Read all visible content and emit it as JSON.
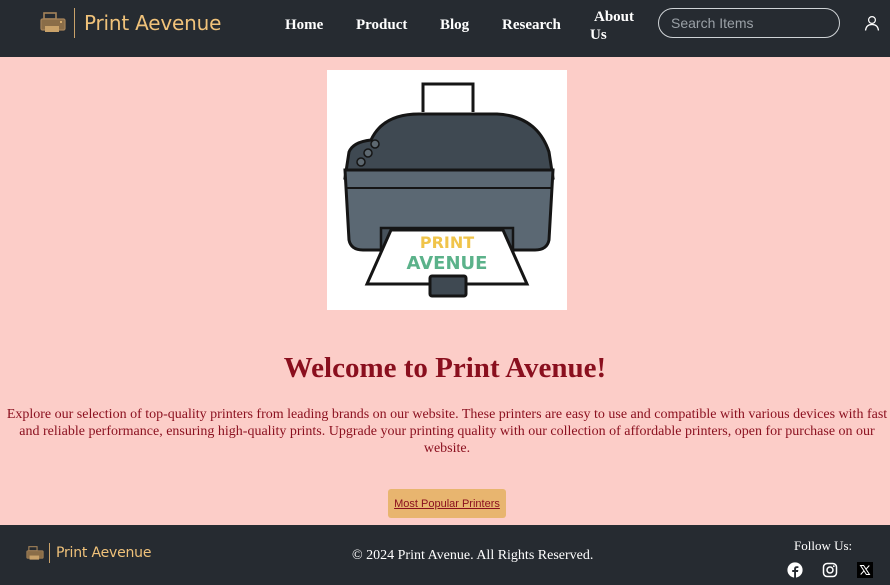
{
  "header": {
    "brand": "Print Aevenue",
    "nav": [
      "Home",
      "Product",
      "Blog",
      "Research"
    ],
    "about_line1": "About",
    "about_line2": "Us",
    "search_placeholder": "Search Items"
  },
  "hero": {
    "image_text_1": "PRINT",
    "image_text_2": "AVENUE",
    "title": "Welcome to Print Avenue!",
    "description": "Explore our selection of top-quality printers from leading brands on our website. These printers are easy to use and compatible with various devices with fast and reliable performance, ensuring high-quality prints. Upgrade your printing quality with our collection of affordable printers, open for purchase on our website.",
    "cta_label": "Most Popular Printers"
  },
  "footer": {
    "brand": "Print Aevenue",
    "copyright": "© 2024 Print Avenue. All Rights Reserved.",
    "follow_label": "Follow Us:",
    "social_icons": [
      "facebook-icon",
      "instagram-icon",
      "x-icon"
    ]
  },
  "colors": {
    "header_bg": "#262b31",
    "page_bg": "#fccdc8",
    "accent": "#8a0f1e",
    "brand_gold": "#f0c27a",
    "button_bg": "#e8b56f"
  }
}
